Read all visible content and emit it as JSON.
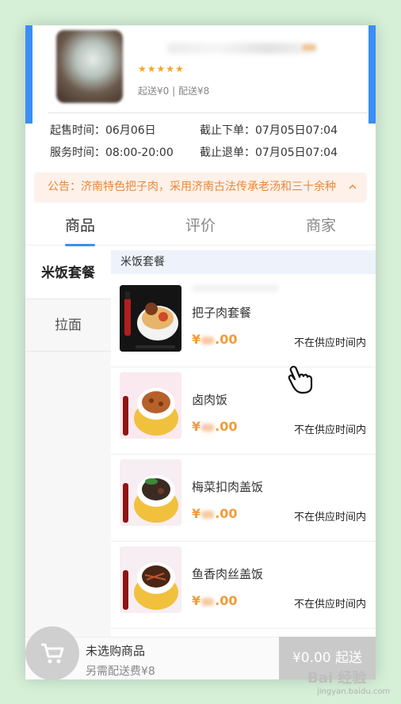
{
  "store": {
    "rating_stars": "★★★★★",
    "fees": "起送¥0 | 配送¥8"
  },
  "schedule": {
    "sale_time_label": "起售时间：",
    "sale_time_value": "06月06日",
    "order_deadline_label": "截止下单：",
    "order_deadline_value": "07月05日07:04",
    "service_time_label": "服务时间：",
    "service_time_value": "08:00-20:00",
    "refund_deadline_label": "截止退单：",
    "refund_deadline_value": "07月05日07:04"
  },
  "announcement": {
    "text": "公告：济南特色把子肉，采用济南古法传承老汤和三十余种",
    "expand_icon": "chevron-up-icon"
  },
  "tabs": [
    {
      "label": "商品"
    },
    {
      "label": "评价"
    },
    {
      "label": "商家"
    }
  ],
  "categories": [
    {
      "label": "米饭套餐"
    },
    {
      "label": "拉面"
    }
  ],
  "section_title": "米饭套餐",
  "foods": [
    {
      "name": "把子肉套餐",
      "price_prefix": "¥",
      "price_suffix": ".00",
      "status": "不在供应时间内"
    },
    {
      "name": "卤肉饭",
      "price_prefix": "¥",
      "price_suffix": ".00",
      "status": "不在供应时间内"
    },
    {
      "name": "梅菜扣肉盖饭",
      "price_prefix": "¥",
      "price_suffix": ".00",
      "status": "不在供应时间内"
    },
    {
      "name": "鱼香肉丝盖饭",
      "price_prefix": "¥",
      "price_suffix": ".00",
      "status": "不在供应时间内"
    }
  ],
  "cart": {
    "status": "未选购商品",
    "fee_note": "另需配送费¥8",
    "checkout_label": "¥0.00 起送",
    "icon": "cart-icon"
  },
  "watermark": {
    "brand": "Bai 经验",
    "url": "jingyan.baidu.com"
  },
  "colors": {
    "accent_blue": "#3a8ef5",
    "price_orange": "#f29b38",
    "announcement_orange": "#e8883a",
    "background_green": "#d6f0d8"
  }
}
